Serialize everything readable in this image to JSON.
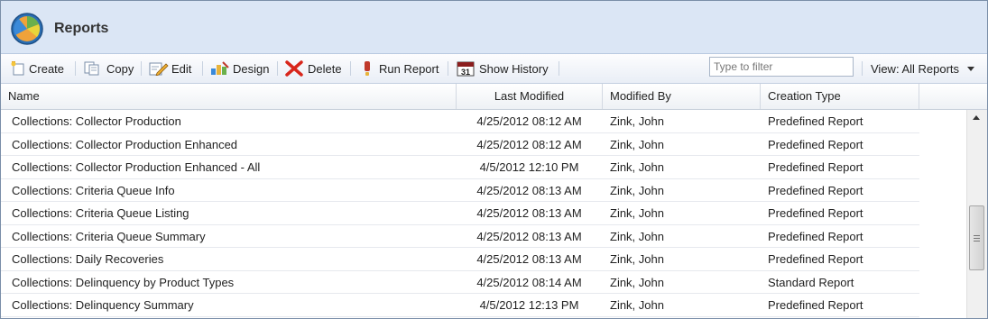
{
  "app": {
    "title": "Reports"
  },
  "toolbar": {
    "create": "Create",
    "copy": "Copy",
    "edit": "Edit",
    "design": "Design",
    "delete": "Delete",
    "run_report": "Run Report",
    "show_history": "Show History",
    "filter_placeholder": "Type to filter",
    "view_label": "View: All Reports"
  },
  "icons": {
    "app": "pie-chart-icon",
    "create": "create-icon",
    "copy": "copy-icon",
    "edit": "edit-icon",
    "design": "design-icon",
    "delete": "delete-icon",
    "run_report": "run-icon",
    "show_history": "calendar-icon"
  },
  "colors": {
    "delete_x": "#d8261b",
    "title_bar": "#dbe6f5",
    "run_icon": "#c0392b"
  },
  "grid": {
    "columns": [
      "Name",
      "Last Modified",
      "Modified By",
      "Creation Type"
    ],
    "rows": [
      {
        "name": "Collections: Collector Production",
        "modified": "4/25/2012 08:12 AM",
        "by": "Zink, John",
        "type": "Predefined Report"
      },
      {
        "name": "Collections: Collector Production Enhanced",
        "modified": "4/25/2012 08:12 AM",
        "by": "Zink, John",
        "type": "Predefined Report"
      },
      {
        "name": "Collections: Collector Production Enhanced - All",
        "modified": "4/5/2012 12:10 PM",
        "by": "Zink, John",
        "type": "Predefined Report"
      },
      {
        "name": "Collections: Criteria Queue Info",
        "modified": "4/25/2012 08:13 AM",
        "by": "Zink, John",
        "type": "Predefined Report"
      },
      {
        "name": "Collections: Criteria Queue Listing",
        "modified": "4/25/2012 08:13 AM",
        "by": "Zink, John",
        "type": "Predefined Report"
      },
      {
        "name": "Collections: Criteria Queue Summary",
        "modified": "4/25/2012 08:13 AM",
        "by": "Zink, John",
        "type": "Predefined Report"
      },
      {
        "name": "Collections: Daily Recoveries",
        "modified": "4/25/2012 08:13 AM",
        "by": "Zink, John",
        "type": "Predefined Report"
      },
      {
        "name": "Collections: Delinquency by Product Types",
        "modified": "4/25/2012 08:14 AM",
        "by": "Zink, John",
        "type": "Standard Report"
      },
      {
        "name": "Collections: Delinquency Summary",
        "modified": "4/5/2012 12:13 PM",
        "by": "Zink, John",
        "type": "Predefined Report"
      }
    ]
  }
}
